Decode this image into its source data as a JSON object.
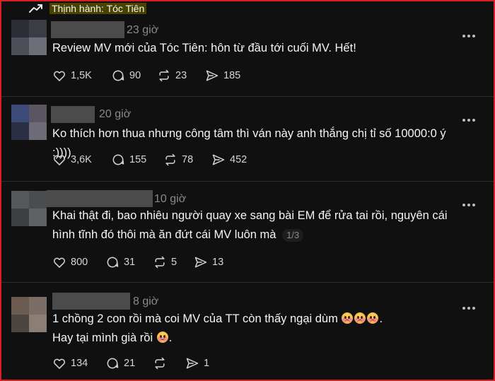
{
  "header": {
    "trending_label": "Thịnh hành: Tóc Tiên",
    "trend_icon": "trending-up-icon"
  },
  "posts": [
    {
      "time": "23 giờ",
      "text": "Review MV mới của Tóc Tiên: hôn từ đầu tới cuối MV. Hết!",
      "likes": "1,5K",
      "replies": "90",
      "reposts": "23",
      "shares": "185",
      "avatar_colors": [
        "#2a2d33",
        "#3a3d44",
        "#4b4f57",
        "#6c6f77"
      ]
    },
    {
      "time": "20 giờ",
      "text": "Ko thích hơn thua nhưng công tâm thì ván này anh thắng chị tỉ số 10000:0 ý :))))",
      "likes": "3,6K",
      "replies": "155",
      "reposts": "78",
      "shares": "452",
      "avatar_colors": [
        "#3c4a7a",
        "#5a5560",
        "#2b2f45",
        "#6e6b78"
      ]
    },
    {
      "time": "10 giờ",
      "text": "Khai thật đi, bao nhiêu người quay xe sang bài EM để rửa tai rồi, nguyên cái hình tĩnh đó thôi mà ăn đứt cái MV luôn mà",
      "page_indicator": "1/3",
      "likes": "800",
      "replies": "31",
      "reposts": "5",
      "shares": "13",
      "avatar_colors": [
        "#55585a",
        "#4a4c4e",
        "#3d3f41",
        "#5f6163"
      ]
    },
    {
      "time": "8 giờ",
      "text_line1": "1 chồng 2 con rồi mà coi MV của TT còn thấy ngại dùm",
      "text_line1_end": ".",
      "text_line2": "Hay tại mình già rồi",
      "text_line2_end": ".",
      "likes": "134",
      "replies": "21",
      "reposts": "",
      "shares": "1",
      "avatar_colors": [
        "#6a5a50",
        "#7a6e66",
        "#4d4540",
        "#8a7e75"
      ]
    }
  ],
  "icons": {
    "like": "heart-icon",
    "reply": "comment-icon",
    "repost": "repost-icon",
    "share": "share-icon",
    "more": "more-icon",
    "emoji": "pleading-face-emoji"
  }
}
